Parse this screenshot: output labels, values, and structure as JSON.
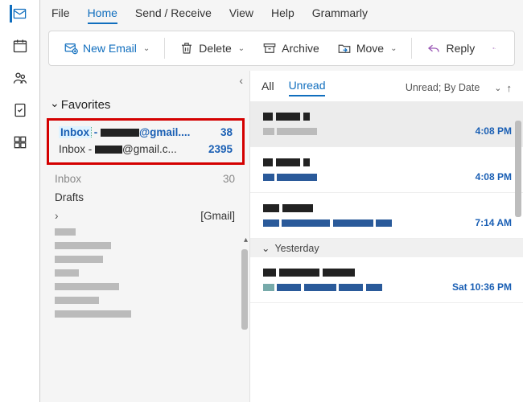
{
  "menu": {
    "file": "File",
    "home": "Home",
    "sendrecv": "Send / Receive",
    "view": "View",
    "help": "Help",
    "grammarly": "Grammarly"
  },
  "toolbar": {
    "new_email": "New Email",
    "delete": "Delete",
    "archive": "Archive",
    "move": "Move",
    "reply": "Reply"
  },
  "folders": {
    "favorites": "Favorites",
    "inbox1_prefix": "Inbox",
    "inbox1_suffix": "@gmail....",
    "inbox1_count": "38",
    "inbox2_label": "Inbox - ",
    "inbox2_suffix": "@gmail.c...",
    "inbox2_count": "2395",
    "inbox_plain": "Inbox",
    "inbox_plain_count": "30",
    "drafts": "Drafts",
    "gmail": "[Gmail]"
  },
  "messages": {
    "tab_all": "All",
    "tab_unread": "Unread",
    "sort_label": "Unread; By Date",
    "group_yesterday": "Yesterday",
    "items": [
      {
        "time": "4:08 PM"
      },
      {
        "time": "4:08 PM"
      },
      {
        "time": "7:14 AM"
      },
      {
        "time": "Sat 10:36 PM"
      }
    ]
  }
}
